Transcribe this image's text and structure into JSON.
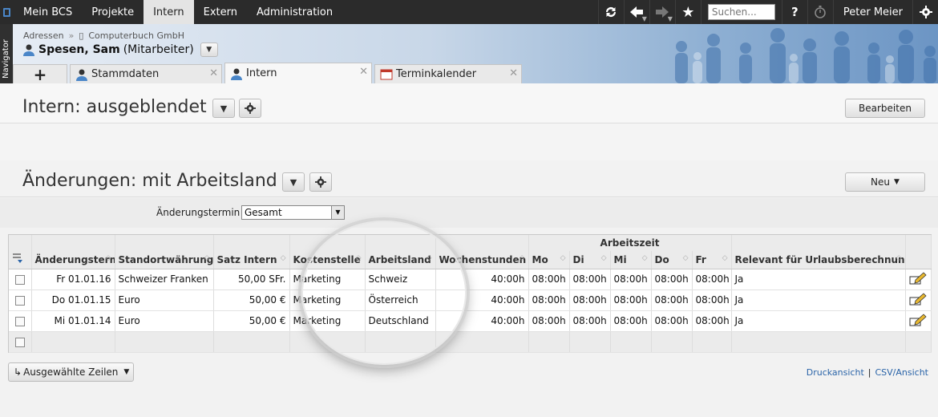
{
  "topnav": {
    "items": [
      "Mein BCS",
      "Projekte",
      "Intern",
      "Extern",
      "Administration"
    ],
    "active": "Intern",
    "search_placeholder": "Suchen...",
    "help": "?",
    "user": "Peter Meier"
  },
  "navigator": {
    "label": "Navigator"
  },
  "header": {
    "breadcrumb": [
      "Adressen",
      "Computerbuch GmbH"
    ],
    "person_name": "Spesen, Sam",
    "person_role": "(Mitarbeiter)"
  },
  "tabs": [
    {
      "label": "+"
    },
    {
      "label": "Stammdaten"
    },
    {
      "label": "Intern",
      "active": true
    },
    {
      "label": "Terminkalender"
    }
  ],
  "section1": {
    "title": "Intern: ausgeblendet",
    "action": "Bearbeiten"
  },
  "section2": {
    "title": "Änderungen: mit Arbeitsland",
    "action": "Neu"
  },
  "filter": {
    "label": "Änderungstermin",
    "value": "Gesamt"
  },
  "table": {
    "group_header": "Arbeitszeit",
    "columns": [
      "Änderungstermin",
      "Standortwährung",
      "Satz Intern",
      "Kostenstelle",
      "Arbeitsland",
      "Wochenstunden",
      "Mo",
      "Di",
      "Mi",
      "Do",
      "Fr",
      "Relevant für Urlaubsberechnung?"
    ],
    "rows": [
      [
        "Fr 01.01.16",
        "Schweizer Franken",
        "50,00 SFr.",
        "Marketing",
        "Schweiz",
        "40:00h",
        "08:00h",
        "08:00h",
        "08:00h",
        "08:00h",
        "08:00h",
        "Ja"
      ],
      [
        "Do 01.01.15",
        "Euro",
        "50,00 €",
        "Marketing",
        "Österreich",
        "40:00h",
        "08:00h",
        "08:00h",
        "08:00h",
        "08:00h",
        "08:00h",
        "Ja"
      ],
      [
        "Mi 01.01.14",
        "Euro",
        "50,00 €",
        "Marketing",
        "Deutschland",
        "40:00h",
        "08:00h",
        "08:00h",
        "08:00h",
        "08:00h",
        "08:00h",
        "Ja"
      ]
    ]
  },
  "bottom": {
    "selected_rows_button": "Ausgewählte Zeilen",
    "print_link": "Druckansicht",
    "csv_link": "CSV/Ansicht"
  },
  "colors": {
    "topbar": "#2b2b2b",
    "link": "#2a64a8",
    "accent": "#4a86c8"
  }
}
